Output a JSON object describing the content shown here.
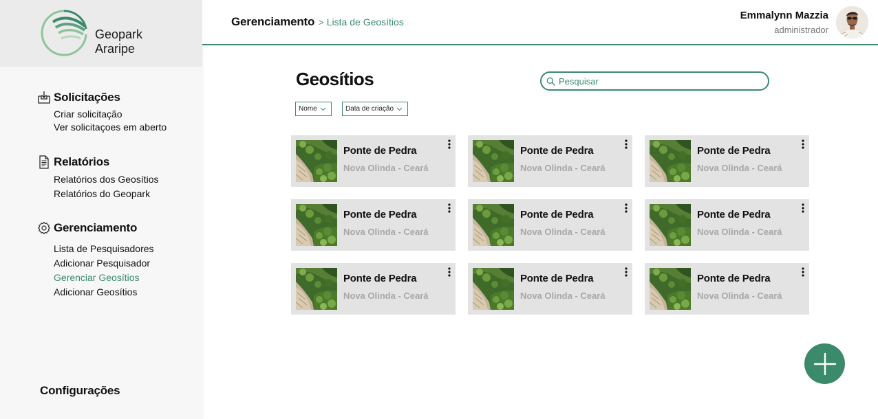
{
  "brand": {
    "line1": "Geopark",
    "line2": "Araripe"
  },
  "sidebar": {
    "sections": [
      {
        "title": "Solicitações",
        "icon": "inbox-download-icon",
        "links": [
          "Criar solicitação",
          "Ver solicitaçoes em aberto"
        ]
      },
      {
        "title": "Relatórios",
        "icon": "document-icon",
        "links": [
          "Relatórios dos Geosítios",
          "Relatórios do Geopark"
        ]
      },
      {
        "title": "Gerenciamento",
        "icon": "gear-icon",
        "links": [
          "Lista de Pesquisadores",
          "Adicionar Pesquisador",
          "Gerenciar Geosítios",
          "Adicionar Geosítios"
        ],
        "active_link": "Gerenciar Geosítios"
      }
    ],
    "config_label": "Configurações"
  },
  "header": {
    "breadcrumb_root": "Gerenciamento",
    "breadcrumb_sep": ">",
    "breadcrumb_leaf": "Lista de Geosítios",
    "user_name": "Emmalynn Mazzia",
    "user_role": "administrador"
  },
  "main": {
    "title": "Geosítios",
    "search_placeholder": "Pesquisar",
    "filters": [
      "Nome",
      "Data de criação"
    ],
    "cards": [
      {
        "name": "Ponte de Pedra",
        "location": "Nova Olinda - Ceará"
      },
      {
        "name": "Ponte de Pedra",
        "location": "Nova Olinda - Ceará"
      },
      {
        "name": "Ponte de Pedra",
        "location": "Nova Olinda - Ceará"
      },
      {
        "name": "Ponte de Pedra",
        "location": "Nova Olinda - Ceará"
      },
      {
        "name": "Ponte de Pedra",
        "location": "Nova Olinda - Ceará"
      },
      {
        "name": "Ponte de Pedra",
        "location": "Nova Olinda - Ceará"
      },
      {
        "name": "Ponte de Pedra",
        "location": "Nova Olinda - Ceará"
      },
      {
        "name": "Ponte de Pedra",
        "location": "Nova Olinda - Ceará"
      },
      {
        "name": "Ponte de Pedra",
        "location": "Nova Olinda - Ceará"
      }
    ]
  },
  "fab_icon": "plus-icon",
  "colors": {
    "accent": "#3b8a6c",
    "card_bg": "#e3e3e3",
    "sidebar_bg": "#f7f7f7",
    "logo_bg": "#ebebeb",
    "muted_text": "#a7a7a7"
  }
}
